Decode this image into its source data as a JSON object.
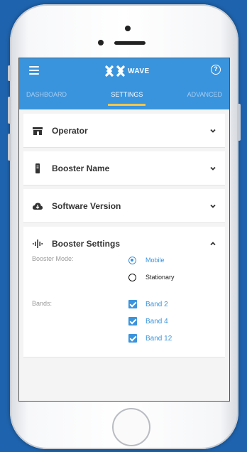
{
  "app": {
    "brand": "WAVE",
    "tabs": [
      {
        "label": "DASHBOARD",
        "active": false
      },
      {
        "label": "SETTINGS",
        "active": true
      },
      {
        "label": "ADVANCED",
        "active": false
      }
    ],
    "accent_color": "#3a94dd",
    "tab_indicator_color": "#f4c74b"
  },
  "sections": [
    {
      "title": "Operator",
      "icon": "store-icon",
      "expanded": false
    },
    {
      "title": "Booster Name",
      "icon": "booster-device-icon",
      "expanded": false
    },
    {
      "title": "Software Version",
      "icon": "cloud-icon",
      "expanded": false
    },
    {
      "title": "Booster Settings",
      "icon": "signal-icon",
      "expanded": true
    }
  ],
  "booster_settings": {
    "mode_label": "Booster Mode:",
    "modes": [
      {
        "label": "Mobile",
        "selected": true
      },
      {
        "label": "Stationary",
        "selected": false
      }
    ],
    "bands_label": "Bands:",
    "bands": [
      {
        "label": "Band 2",
        "checked": true
      },
      {
        "label": "Band 4",
        "checked": true
      },
      {
        "label": "Band 12",
        "checked": true
      }
    ]
  }
}
